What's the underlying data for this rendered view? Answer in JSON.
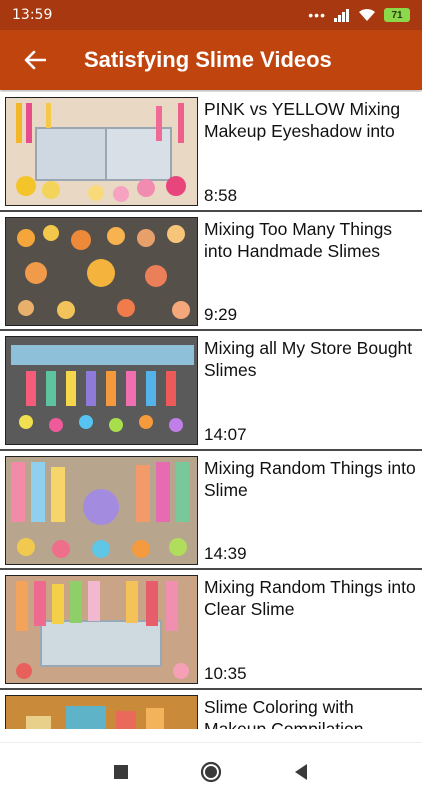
{
  "status_bar": {
    "time": "13:59",
    "dots": "•••",
    "battery": "71",
    "battery_color": "#8bd94a"
  },
  "app_bar": {
    "title": "Satisfying Slime Videos",
    "back_icon": "arrow-left-icon",
    "color": "#c0440e"
  },
  "videos": [
    {
      "title": "PINK vs YELLOW Mixing Makeup Eyeshadow into",
      "duration": "8:58"
    },
    {
      "title": "Mixing Too Many Things into Handmade Slimes",
      "duration": "9:29"
    },
    {
      "title": "Mixing all My Store Bought Slimes",
      "duration": "14:07"
    },
    {
      "title": "Mixing Random Things into Slime",
      "duration": "14:39"
    },
    {
      "title": "Mixing Random Things into Clear Slime",
      "duration": "10:35"
    },
    {
      "title": "Slime Coloring with Makeup Compilation",
      "duration": ""
    }
  ],
  "nav_bar": {
    "recents_icon": "square-icon",
    "home_icon": "circle-icon",
    "back_icon": "triangle-back-icon"
  }
}
